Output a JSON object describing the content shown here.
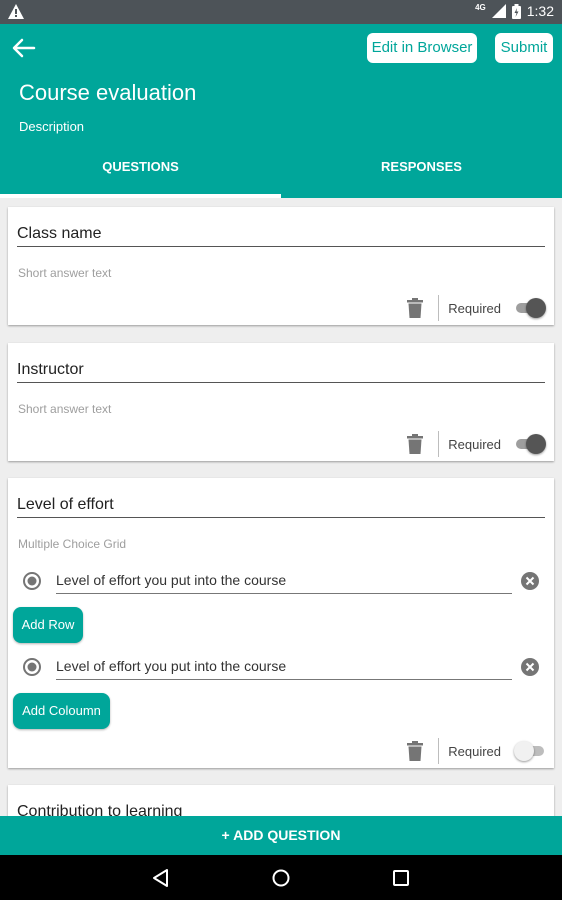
{
  "status_bar": {
    "network": "4G",
    "time": "1:32"
  },
  "header": {
    "edit_button": "Edit in Browser",
    "submit_button": "Submit",
    "title": "Course evaluation",
    "description": "Description"
  },
  "tabs": [
    {
      "label": "QUESTIONS",
      "selected": true
    },
    {
      "label": "RESPONSES",
      "selected": false
    }
  ],
  "questions": [
    {
      "title": "Class name",
      "type": "Short answer text",
      "required_label": "Required",
      "required": true
    },
    {
      "title": "Instructor",
      "type": "Short answer text",
      "required_label": "Required",
      "required": true
    },
    {
      "title": "Level of effort",
      "type": "Multiple Choice Grid",
      "rows": [
        "Level of effort you put into the course"
      ],
      "add_row_label": "Add Row",
      "columns": [
        "Level of effort you put into the course"
      ],
      "add_column_label": "Add Coloumn",
      "required_label": "Required",
      "required": false
    },
    {
      "title": "Contribution to learning"
    }
  ],
  "add_question_label": "+ ADD QUESTION",
  "colors": {
    "accent": "#00a69a",
    "status_bar": "#4d5358",
    "background": "#eeeeee"
  },
  "icons": [
    "warning-icon",
    "signal-icon",
    "battery-icon",
    "back-arrow-icon",
    "trash-icon",
    "radio-icon",
    "remove-icon",
    "nav-back-icon",
    "nav-home-icon",
    "nav-recents-icon"
  ]
}
